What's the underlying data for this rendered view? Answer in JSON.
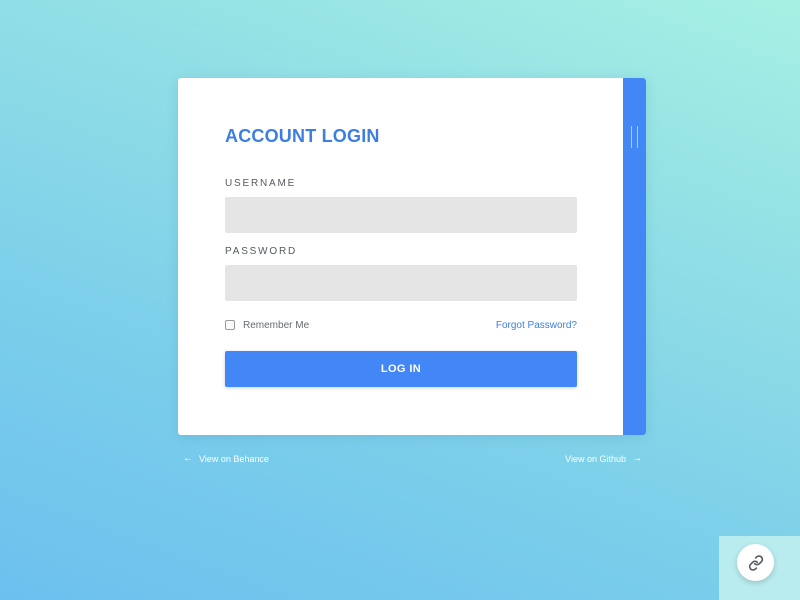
{
  "login_card": {
    "title": "ACCOUNT LOGIN",
    "username_label": "USERNAME",
    "username_value": "",
    "password_label": "PASSWORD",
    "password_value": "",
    "remember_label": "Remember Me",
    "remember_checked": false,
    "forgot_label": "Forgot Password?",
    "submit_label": "LOG IN"
  },
  "footer": {
    "behance_label": "View on Behance",
    "behance_icon": "arrow-left-icon",
    "github_label": "View on Github",
    "github_icon": "arrow-right-icon"
  },
  "fab": {
    "icon": "link-icon"
  },
  "colors": {
    "accent": "#4287f5",
    "title": "#3d7fe0",
    "input_bg": "#e5e5e5",
    "background_top": "#a6f0e3",
    "background_bottom": "#6cc0ee"
  }
}
